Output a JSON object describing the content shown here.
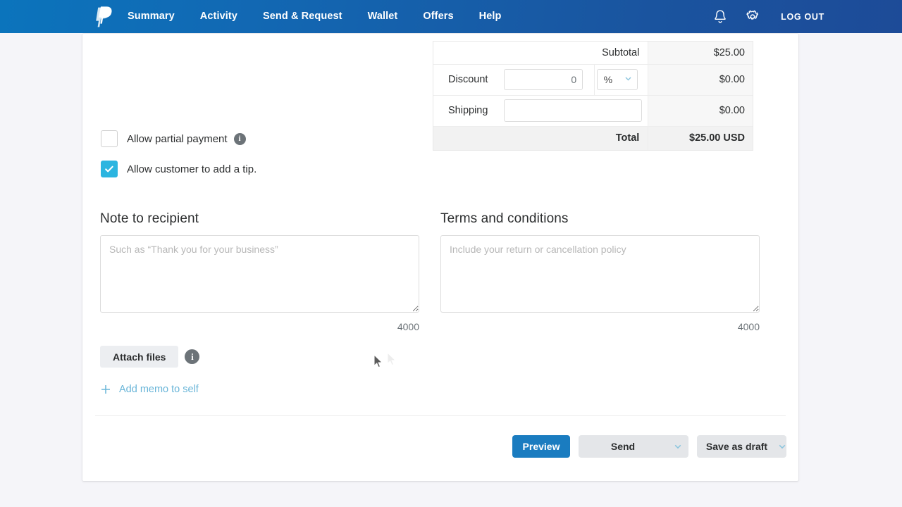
{
  "header": {
    "logo": "paypal-logo",
    "nav": [
      {
        "label": "Summary"
      },
      {
        "label": "Activity"
      },
      {
        "label": "Send & Request"
      },
      {
        "label": "Wallet"
      },
      {
        "label": "Offers"
      },
      {
        "label": "Help"
      }
    ],
    "notifications_icon": "bell-icon",
    "settings_icon": "gear-icon",
    "logout_label": "LOG OUT",
    "gradient_from": "#0b74bc",
    "gradient_to": "#1d4b98"
  },
  "totals": {
    "subtotal_label": "Subtotal",
    "subtotal_amount": "$25.00",
    "discount_label": "Discount",
    "discount_value": "0",
    "discount_placeholder": "0",
    "discount_unit": "%",
    "discount_amount": "$0.00",
    "shipping_label": "Shipping",
    "shipping_value": "",
    "shipping_placeholder": "",
    "shipping_amount": "$0.00",
    "total_label": "Total",
    "total_amount": "$25.00 USD"
  },
  "options": {
    "partial_payment_label": "Allow partial payment",
    "partial_payment_checked": "false",
    "partial_payment_info": "i",
    "tip_label": "Allow customer to add a tip.",
    "tip_checked": "true"
  },
  "note": {
    "title": "Note to recipient",
    "placeholder": "Such as “Thank you for your business”",
    "value": "",
    "counter": "4000"
  },
  "terms": {
    "title": "Terms and conditions",
    "placeholder": "Include your return or cancellation policy",
    "value": "",
    "counter": "4000"
  },
  "attachments": {
    "attach_label": "Attach files",
    "attach_info": "i",
    "memo_label": "Add memo to self",
    "memo_icon": "plus-icon"
  },
  "footer": {
    "preview_label": "Preview",
    "send_label": "Send",
    "draft_label": "Save as draft",
    "caret_icon": "chevron-down-icon",
    "preview_color": "#1a7cc0"
  },
  "cursor": {
    "icon": "mouse-pointer-icon"
  }
}
